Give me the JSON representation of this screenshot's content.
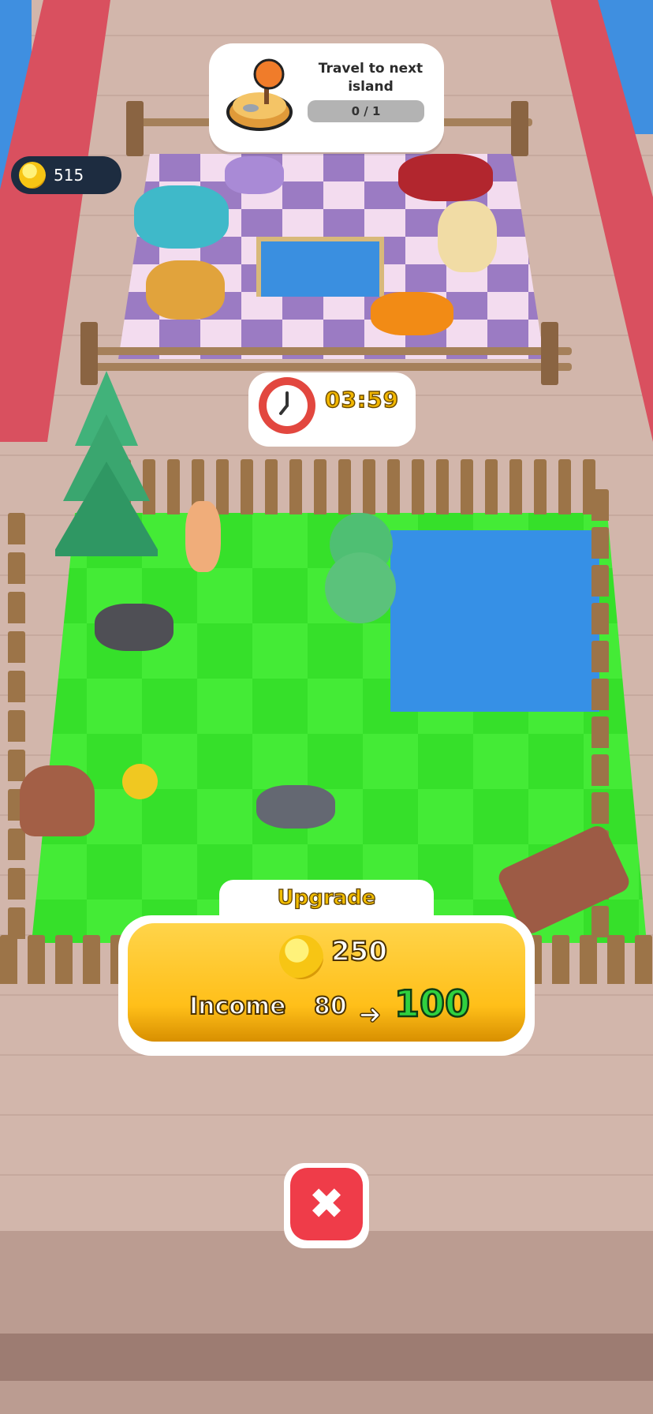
{
  "goal": {
    "title": "Travel to next island",
    "progress_text": "0 / 1",
    "icon": "island-tree-icon"
  },
  "wallet": {
    "coins": "515",
    "icon": "coin-icon"
  },
  "timer": {
    "value": "03:59",
    "icon": "clock-icon"
  },
  "upgrade": {
    "label": "Upgrade",
    "cost": "250",
    "income_label": "Income",
    "income_current": "80",
    "income_next": "100",
    "arrow": "➜"
  },
  "close": {
    "icon": "close-x-icon",
    "glyph": "✖"
  },
  "colors": {
    "accent": "#ffc93a",
    "close": "#ef3c49",
    "income_new": "#2fd13f",
    "timer": "#f3b800"
  }
}
